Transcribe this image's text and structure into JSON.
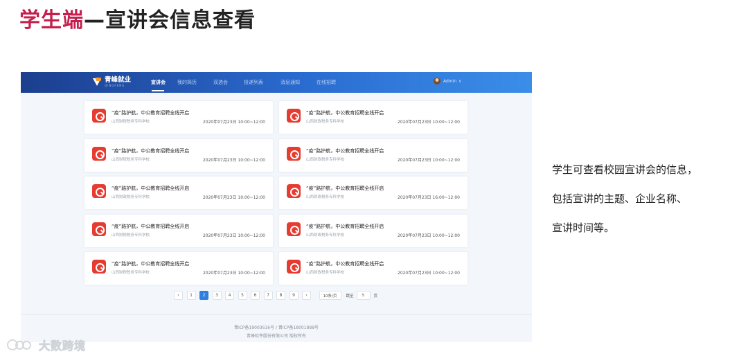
{
  "slide": {
    "title_accent": "学生端",
    "title_rest": "—宣讲会信息查看",
    "description": [
      "学生可查看校园宣讲会的信息，",
      "包括宣讲的主题、企业名称、",
      "宣讲时间等。"
    ],
    "watermark": "大数跨境"
  },
  "app": {
    "logo_name": "青峰就业",
    "logo_sub": "QINGFENG",
    "nav": [
      "宣讲会",
      "我的简历",
      "双选会",
      "投递列表",
      "消息通知",
      "在线招聘"
    ],
    "active_nav": "宣讲会",
    "user_name": "Admin",
    "user_caret": "∨"
  },
  "cards": [
    {
      "title": "“疫”路护航，中公教育招聘全线开启",
      "org": "山西财税税务专科学校",
      "time": "2020年07月23日 10:00~12:00"
    },
    {
      "title": "“疫”路护航，中公教育招聘全线开启",
      "org": "山西财政税务专科学校",
      "time": "2020年07月23日 10:00~12:00"
    },
    {
      "title": "“疫”路护航，中公教育招聘全线开启",
      "org": "山西财税税务专科学校",
      "time": "2020年07月23日 10:00~12:00"
    },
    {
      "title": "“疫”路护航，中公教育招聘全线开启",
      "org": "山西财政税务专科学校",
      "time": "2020年07月23日 10:00~12:00"
    },
    {
      "title": "“疫”路护航，中公教育招聘全线开启",
      "org": "山西财政税务专科学校",
      "time": "2020年07月23日 10:00~12:00"
    },
    {
      "title": "“疫”路护航，中公教育招聘全线开启",
      "org": "山西财政税务专科学校",
      "time": "2020年07月23日 16:00~12:00"
    },
    {
      "title": "“疫”路护航，中公教育招聘全线开启",
      "org": "山西财税税务专科学校",
      "time": "2020年07月23日 10:00~12:00"
    },
    {
      "title": "“疫”路护航，中公教育招聘全线开启",
      "org": "山西财政税务专科学校",
      "time": "2020年07月23日 10:00~12:00"
    },
    {
      "title": "“疫”路护航，中公教育招聘全线开启",
      "org": "山西财税税务专科学校",
      "time": "2020年07月23日 10:00~12:00"
    },
    {
      "title": "“疫”路护航，中公教育招聘全线开启",
      "org": "山西财政税务专科学校",
      "time": "2020年07月23日 10:00~12:00"
    }
  ],
  "pagination": {
    "prev": "‹",
    "next": "›",
    "pages": [
      "1",
      "2",
      "3",
      "4",
      "5",
      "6",
      "7",
      "8",
      "9"
    ],
    "current": "2",
    "page_size": "10条/页",
    "jump_label": "跳至",
    "jump_value": "5",
    "jump_unit": "页"
  },
  "footer": {
    "line1": "晋ICP备19003616号 / 晋ICP备18001888号",
    "line2": "青峰软件股份有限公司 版权所有"
  },
  "colors": {
    "title_accent": "#c41f4d",
    "nav_start": "#1c3e8e",
    "nav_end": "#3a8ee8",
    "card_icon": "#e63b30",
    "pager_active": "#2d7fe0"
  },
  "icons": {
    "card": "magnifier-icon",
    "logo": "qingfeng-logo-icon",
    "user": "avatar-icon"
  }
}
